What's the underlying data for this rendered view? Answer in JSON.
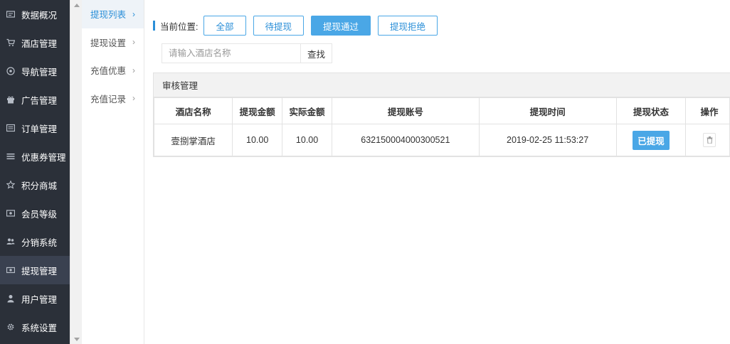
{
  "sidebar": {
    "items": [
      {
        "label": "数据概况",
        "icon": "dashboard-icon",
        "active": false
      },
      {
        "label": "酒店管理",
        "icon": "cart-icon",
        "active": false
      },
      {
        "label": "导航管理",
        "icon": "compass-icon",
        "active": false
      },
      {
        "label": "广告管理",
        "icon": "gift-icon",
        "active": false
      },
      {
        "label": "订单管理",
        "icon": "order-list-icon",
        "active": false
      },
      {
        "label": "优惠券管理",
        "icon": "menu-lines-icon",
        "active": false
      },
      {
        "label": "积分商城",
        "icon": "star-icon",
        "active": false
      },
      {
        "label": "会员等级",
        "icon": "member-card-icon",
        "active": false
      },
      {
        "label": "分销系统",
        "icon": "users-icon",
        "active": false
      },
      {
        "label": "提现管理",
        "icon": "money-icon",
        "active": true
      },
      {
        "label": "用户管理",
        "icon": "user-icon",
        "active": false
      },
      {
        "label": "系统设置",
        "icon": "gear-icon",
        "active": false
      }
    ]
  },
  "submenu": {
    "items": [
      {
        "label": "提现列表",
        "active": true
      },
      {
        "label": "提现设置",
        "active": false
      },
      {
        "label": "充值优惠",
        "active": false
      },
      {
        "label": "充值记录",
        "active": false
      }
    ],
    "arrow": "›"
  },
  "breadcrumb": {
    "label": "当前位置:",
    "tabs": [
      {
        "label": "全部",
        "active": false
      },
      {
        "label": "待提现",
        "active": false
      },
      {
        "label": "提现通过",
        "active": true
      },
      {
        "label": "提现拒绝",
        "active": false
      }
    ]
  },
  "search": {
    "placeholder": "请输入酒店名称",
    "value": "",
    "button_label": "查找"
  },
  "panel": {
    "title": "审核管理"
  },
  "table": {
    "columns": [
      "酒店名称",
      "提现金额",
      "实际金额",
      "提现账号",
      "提现时间",
      "提现状态",
      "操作"
    ],
    "rows": [
      {
        "hotel_name": "壹捌掌酒店",
        "amount": "10.00",
        "actual_amount": "10.00",
        "account": "632150004000300521",
        "time": "2019-02-25 11:53:27",
        "status": "已提现"
      }
    ]
  },
  "colors": {
    "accent": "#4aa7e6",
    "sidebar_bg": "#2b3039",
    "sidebar_active": "#3a4150"
  }
}
